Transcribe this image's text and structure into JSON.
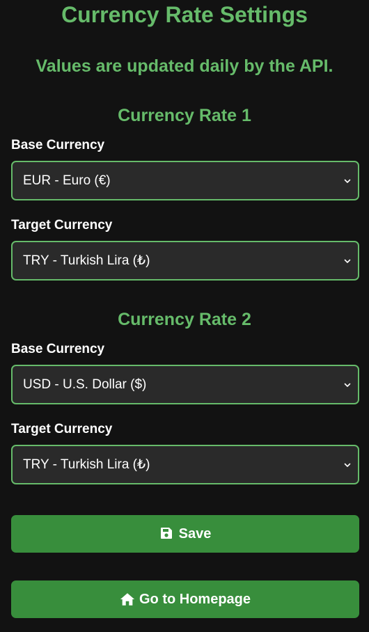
{
  "page": {
    "title": "Currency Rate Settings",
    "subtitle": "Values are updated daily by the API."
  },
  "rates": [
    {
      "heading": "Currency Rate 1",
      "base_label": "Base Currency",
      "base_value": "EUR - Euro (€)",
      "target_label": "Target Currency",
      "target_value": "TRY - Turkish Lira (₺)"
    },
    {
      "heading": "Currency Rate 2",
      "base_label": "Base Currency",
      "base_value": "USD - U.S. Dollar ($)",
      "target_label": "Target Currency",
      "target_value": "TRY - Turkish Lira (₺)"
    }
  ],
  "actions": {
    "save_label": "Save",
    "home_label": "Go to Homepage"
  },
  "colors": {
    "background": "#121212",
    "accent": "#66bb6a",
    "button": "#388e3c",
    "field_bg": "#2a2a2a"
  },
  "icons": {
    "save": "floppy-disk-icon",
    "home": "house-icon",
    "dropdown": "chevron-down-icon"
  }
}
